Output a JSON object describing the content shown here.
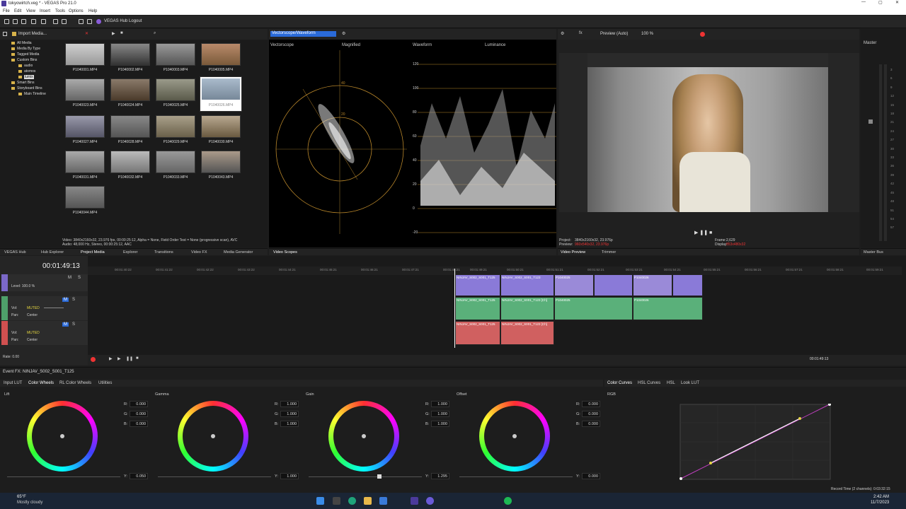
{
  "window": {
    "title": "tokyowirtch.veg * - VEGAS Pro 21.0"
  },
  "menu": [
    "File",
    "Edit",
    "View",
    "Insert",
    "Tools",
    "Options",
    "Help"
  ],
  "toolbar": {
    "hub_label": "VEGAS Hub Logout"
  },
  "explorer": {
    "import_label": "Import Media...",
    "tree": [
      "All Media",
      "Media By Type",
      "Tagged Media",
      "Custom Bins",
      "audio",
      "atomos",
      "lumix",
      "Smart Bins",
      "Storyboard Bins",
      "Main Timeline"
    ],
    "thumbnails": [
      "P1040001.MP4",
      "P1040002.MP4",
      "P1040003.MP4",
      "P1040005.MP4",
      "P1040023.MP4",
      "P1040024.MP4",
      "P1040025.MP4",
      "P1040026.MP4",
      "P1040027.MP4",
      "P1040028.MP4",
      "P1040029.MP4",
      "P1040030.MP4",
      "P1040031.MP4",
      "P1040032.MP4",
      "P1040033.MP4",
      "P1040043.MP4",
      "P1040044.MP4"
    ],
    "info_line1": "Video: 3840x2160x32, 23.976 fps, 00:00:25:12, Alpha = None, Field Order Test = None (progressive scan), AVC",
    "info_line2": "Audio: 48,000 Hz, Stereo, 00:00:25:12, AAC"
  },
  "left_tabs": [
    "VEGAS Hub",
    "Hub Explorer",
    "Project Media",
    "Explorer",
    "Transitions",
    "Video FX",
    "Media Generator"
  ],
  "scopes": {
    "selector": "Vectorscope/Waveform",
    "vectorscope_label": "Vectorscope",
    "magnified_label": "Magnified",
    "waveform_label": "Waveform",
    "luminance_label": "Luminance",
    "tab": "Video Scopes",
    "wf_ticks": [
      "120",
      "100",
      "80",
      "60",
      "40",
      "20",
      "0",
      "-20"
    ],
    "vs_ticks": [
      "40",
      "20"
    ]
  },
  "preview": {
    "mode": "Preview (Auto)",
    "zoom": "100 %",
    "project_label": "Project:",
    "project_value": "3840x2160x32, 23.976p",
    "preview_label": "Preview:",
    "preview_value": "960x540x32, 23.976p",
    "frame_label": "Frame:",
    "frame_value": "2,629",
    "display_label": "Display:",
    "display_value": "853x480x32",
    "tabs": [
      "Video Preview",
      "Trimmer"
    ]
  },
  "master": {
    "label": "Master",
    "tab": "Master Bus",
    "meter_ticks": [
      "3",
      "6",
      "9",
      "12",
      "15",
      "18",
      "21",
      "24",
      "27",
      "30",
      "33",
      "36",
      "39",
      "42",
      "45",
      "48",
      "51",
      "54",
      "57"
    ]
  },
  "timeline": {
    "timecode": "00:01:49:13",
    "ruler": [
      "00:01:40:22",
      "00:01:41:22",
      "00:01:42:22",
      "00:01:43:22",
      "00:01:44:21",
      "00:01:45:21",
      "00:01:46:21",
      "00:01:47:21",
      "00:01:48:21",
      "00:01:49:21",
      "00:01:50:21",
      "00:01:51:21",
      "00:01:52:21",
      "00:01:53:21",
      "00:01:54:21",
      "00:01:55:21",
      "00:01:56:21",
      "00:01:57:21",
      "00:01:58:21",
      "00:01:59:21"
    ],
    "level": "Level: 100.0 %",
    "audio1": {
      "vol": "Vol:",
      "muted": "MUTED",
      "pan": "Pan:",
      "center": "Center"
    },
    "audio2": {
      "vol": "Vol:",
      "muted": "MUTED",
      "pan": "Pan:",
      "center": "Center"
    },
    "clips_v": [
      "NINJAV_S002_S001_T125",
      "NINJAV_S002_S001_T123",
      "P1040025",
      "",
      "P1040026",
      ""
    ],
    "clips_a1": [
      "NINJAV_S002_S001_T125",
      "NINJAV_S002_S001_T123 [Ch]",
      "P1040025",
      "P1040026"
    ],
    "clips_a2": [
      "NINJAV_S002_S001_T125",
      "NINJAV_S002_S001_T123 [Ch]"
    ],
    "rate": "Rate: 0.00",
    "cursor_time": "00:01:49:13",
    "m": "M",
    "s": "S",
    "fx": "fx"
  },
  "event_fx": {
    "title": "Event FX: NINJAV_S002_S001_T125",
    "tabs": [
      "Input LUT",
      "Color Wheels",
      "RL Color Wheels",
      "Utilities"
    ],
    "wheels": [
      {
        "name": "Lift",
        "r": "0.000",
        "g": "0.000",
        "b": "0.000",
        "y": "0.050"
      },
      {
        "name": "Gamma",
        "r": "1.000",
        "g": "1.000",
        "b": "1.000",
        "y": "1.000"
      },
      {
        "name": "Gain",
        "r": "1.000",
        "g": "1.000",
        "b": "1.000",
        "y": "1.295"
      },
      {
        "name": "Offset",
        "r": "0.000",
        "g": "0.000",
        "b": "0.000",
        "y": "0.000"
      }
    ],
    "rgb_labels": {
      "r": "R:",
      "g": "G:",
      "b": "B:",
      "y": "Y:"
    },
    "curve_tabs": [
      "Color Curves",
      "HSL Curves",
      "HSL",
      "Look LUT"
    ],
    "curve_channel": "RGB",
    "curve_color": "#c23fc2",
    "record_time": "Record Time (2 channels): 0:03:32:15"
  },
  "taskbar": {
    "temp": "65°F",
    "weather": "Mostly cloudy",
    "time": "2:42 AM",
    "date": "11/7/2023"
  }
}
